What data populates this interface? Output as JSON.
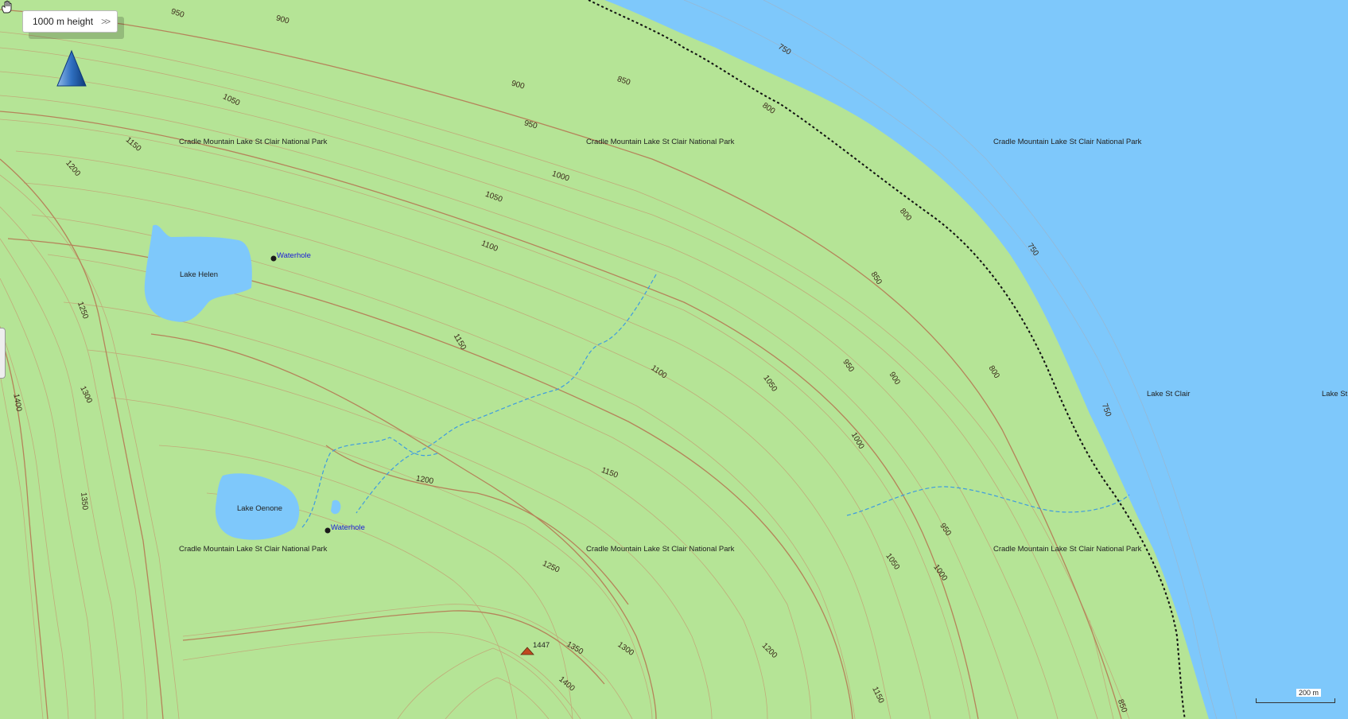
{
  "tooltip": {
    "label": "1000 m height",
    "more": ">>"
  },
  "park_labels": [
    "Cradle Mountain Lake St Clair National Park",
    "Cradle Mountain Lake St Clair National Park",
    "Cradle Mountain Lake St Clair National Park",
    "Cradle Mountain Lake St Clair National Park",
    "Cradle Mountain Lake St Clair National Park",
    "Cradle Mountain Lake St Clair National Park"
  ],
  "lakes": {
    "helen": "Lake Helen",
    "oenone": "Lake Oenone",
    "st_clair": "Lake St Clair",
    "st_clair_cut": "Lake St"
  },
  "waterholes": [
    "Waterhole",
    "Waterhole"
  ],
  "peak": {
    "elevation": "1447"
  },
  "contours": [
    "950",
    "900",
    "1050",
    "1150",
    "1200",
    "900",
    "850",
    "950",
    "1000",
    "1050",
    "1100",
    "750",
    "800",
    "800",
    "850",
    "750",
    "1250",
    "1150",
    "1100",
    "1050",
    "950",
    "900",
    "800",
    "1300",
    "1400",
    "1350",
    "1000",
    "1200",
    "1150",
    "750",
    "950",
    "1250",
    "1350",
    "1300",
    "1400",
    "1200",
    "1150",
    "1050",
    "1000",
    "850"
  ],
  "scale": {
    "label": "200 m"
  },
  "colors": {
    "land": "#b5e496",
    "water": "#7ec8fb",
    "contour": "#b5835a",
    "stream": "#3d9be0",
    "waterhole": "#1a1a1a"
  },
  "icons": {
    "pan": "hand-icon",
    "compass": "north-arrow-icon",
    "peak": "summit-icon"
  }
}
